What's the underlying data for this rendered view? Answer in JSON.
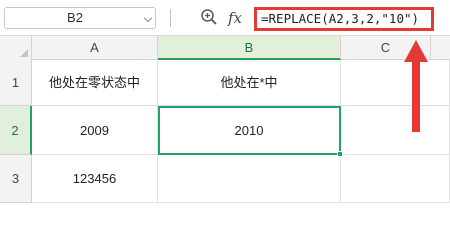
{
  "formula_bar": {
    "name_box": "B2",
    "fx_label": "fx",
    "formula": "=REPLACE(A2,3,2,\"10\")"
  },
  "columns": [
    "A",
    "B",
    "C"
  ],
  "rows": [
    {
      "num": "1",
      "cells": [
        "他处在零状态中",
        "他处在*中",
        ""
      ]
    },
    {
      "num": "2",
      "cells": [
        "2009",
        "2010",
        ""
      ]
    },
    {
      "num": "3",
      "cells": [
        "123456",
        "",
        ""
      ]
    }
  ],
  "selected_cell": "B2",
  "colors": {
    "accent": "#21a366",
    "highlight": "#e53935"
  }
}
